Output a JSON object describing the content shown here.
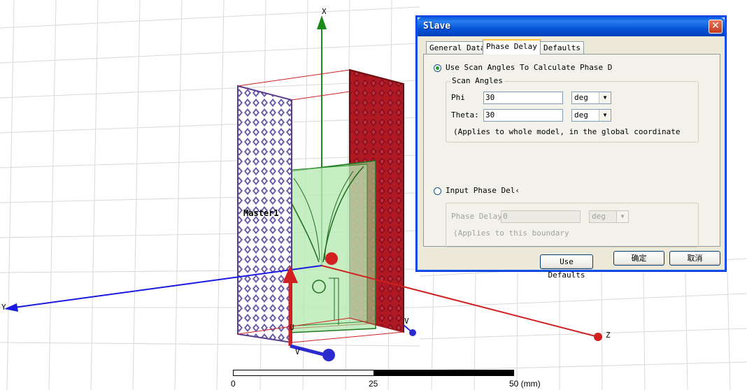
{
  "viewport": {
    "label_master": "Master1",
    "axis_x": "X",
    "axis_y_left": "Y",
    "axis_z": "Z",
    "origin_u": "U",
    "origin_v": "V",
    "right_v": "V",
    "scale": {
      "label_0": "0",
      "label_25": "25",
      "label_50": "50 (mm)"
    },
    "colors": {
      "master": "#5a3c8c",
      "slave": "#b01822",
      "green": "#4fb84f",
      "x_axis": "#1a8a1a",
      "y_axis": "#1a1ae0",
      "z_axis": "#d02020"
    }
  },
  "dialog": {
    "title": "Slave",
    "close_icon": "close-icon",
    "tabs": [
      "General Data",
      "Phase Delay",
      "Defaults"
    ],
    "active_tab": "Phase Delay",
    "radio_scan_label": "Use Scan Angles To Calculate Phase D",
    "scan_group_label": "Scan Angles",
    "phi_label": "Phi",
    "phi_value": "30",
    "phi_unit": "deg",
    "theta_label": "Theta:",
    "theta_value": "30",
    "theta_unit": "deg",
    "scan_note": "(Applies to whole model, in the global coordinate",
    "radio_input_label": "Input Phase Del‹",
    "phase_delay_label": "Phase Delay",
    "phase_delay_value": "0",
    "phase_delay_unit": "deg",
    "boundary_note": "(Applies to this boundary",
    "use_defaults_label": "Use Defaults",
    "ok_label": "确定",
    "cancel_label": "取消"
  }
}
